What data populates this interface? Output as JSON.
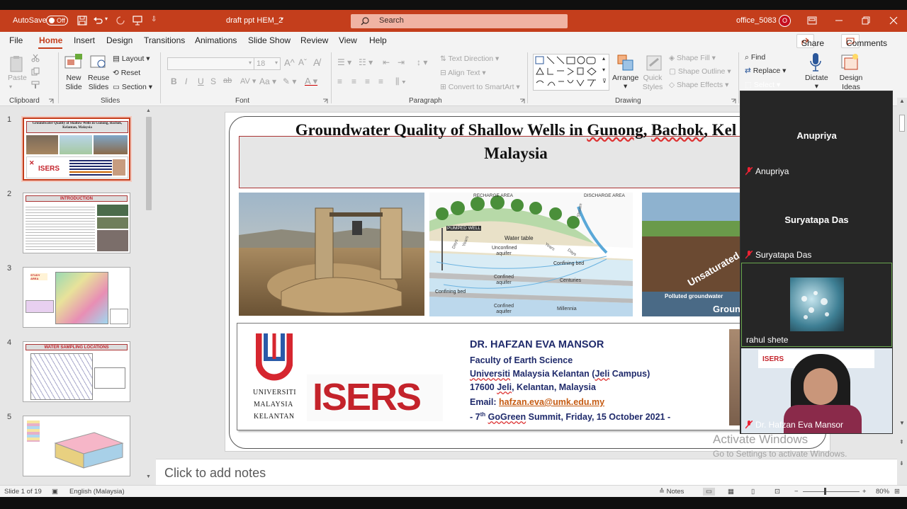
{
  "titlebar": {
    "autosave_label": "AutoSave",
    "autosave_state": "Off",
    "filename": "draft ppt HEM_2",
    "search_placeholder": "Search",
    "account_name": "office_5083",
    "avatar_initial": "O",
    "accent_color": "#c43e1c"
  },
  "menu": {
    "items": [
      "File",
      "Home",
      "Insert",
      "Design",
      "Transitions",
      "Animations",
      "Slide Show",
      "Review",
      "View",
      "Help"
    ],
    "active": "Home",
    "share_label": "Share",
    "comments_label": "Comments"
  },
  "ribbon": {
    "clipboard": {
      "label": "Clipboard",
      "paste": "Paste"
    },
    "slides": {
      "label": "Slides",
      "new_slide": "New Slide",
      "reuse_slides": "Reuse Slides",
      "layout": "Layout",
      "reset": "Reset",
      "section": "Section"
    },
    "font": {
      "label": "Font",
      "size": "18"
    },
    "paragraph": {
      "label": "Paragraph",
      "text_direction": "Text Direction",
      "align_text": "Align Text",
      "convert_smartart": "Convert to SmartArt"
    },
    "drawing": {
      "label": "Drawing",
      "arrange": "Arrange",
      "quick_styles": "Quick Styles",
      "shape_fill": "Shape Fill",
      "shape_outline": "Shape Outline",
      "shape_effects": "Shape Effects"
    },
    "editing": {
      "find": "Find",
      "replace": "Replace",
      "select": "Select"
    },
    "voice": {
      "dictate": "Dictate"
    },
    "designer": {
      "design_ideas": "Design Ideas"
    }
  },
  "thumbnails": [
    {
      "num": "1",
      "title": "Groundwater Quality of Shallow Wells in Gunong, Bachok, Kelantan, Malaysia"
    },
    {
      "num": "2",
      "title": "INTRODUCTION"
    },
    {
      "num": "3",
      "title": "STUDY AREA"
    },
    {
      "num": "4",
      "title": "WATER SAMPLING LOCATIONS"
    },
    {
      "num": "5",
      "title": ""
    }
  ],
  "slide": {
    "title_part1": "Groundwater Quality of Shallow Wells in ",
    "title_gunong": "Gunong",
    "title_sep": ", ",
    "title_bachok": "Bachok",
    "title_part2": ", Kel",
    "title_line2": "Malaysia",
    "diagram_labels": {
      "recharge": "RECHARGE AREA",
      "discharge": "DISCHARGE AREA",
      "pumped_well": "PUMPED WELL",
      "water_table": "Water table",
      "unconfined": "Unconfined aquifer",
      "confining_bed": "Confining bed",
      "confining_bed2": "Confining bed",
      "confined": "Confined aquifer",
      "confined2": "Confined aquifer",
      "centuries": "Centuries",
      "millennia": "Millennia",
      "days": "Days",
      "years": "Years",
      "years2": "Years",
      "days2": "Days",
      "stream": "Stream"
    },
    "photo3_labels": {
      "unsaturated": "Unsaturated",
      "polluted": "Polluted groundwater",
      "ground": "Groun"
    },
    "logo_uni": [
      "UNIVERSITI",
      "MALAYSIA",
      "KELANTAN"
    ],
    "logo_isers": "ISERS",
    "presenter": "DR. HAFZAN EVA MANSOR",
    "faculty": "Faculty of Earth Science",
    "university_u": "Universiti",
    "university_rest": " Malaysia Kelantan (",
    "university_jeli": "Jeli",
    "university_end": " Campus)",
    "address_pre": "17600 ",
    "address_jeli": "Jeli",
    "address_rest": ", Kelantan, Malaysia",
    "email_label": "Email: ",
    "email": "hafzan.eva@umk.edu.my",
    "event_pre": "- 7",
    "event_sup": "th",
    "event_space": " ",
    "event_gogreen": "GoGreen",
    "event_rest": " Summit, Friday, 15 October 2021 -"
  },
  "notes_placeholder": "Click to add notes",
  "status": {
    "slide_of": "Slide 1 of 19",
    "language": "English (Malaysia)",
    "notes": "Notes",
    "zoom": "80%"
  },
  "video": {
    "participants": [
      {
        "big_name": "Anupriya",
        "name": "Anupriya",
        "muted": true
      },
      {
        "big_name": "Suryatapa Das",
        "name": "Suryatapa Das",
        "muted": true
      },
      {
        "big_name": "",
        "name": "rahul shete",
        "muted": false
      },
      {
        "big_name": "",
        "name": "Dr. Hafzan Eva Mansor",
        "muted": true
      }
    ]
  },
  "watermark": {
    "line1": "Activate Windows",
    "line2": "Go to Settings to activate Windows."
  }
}
